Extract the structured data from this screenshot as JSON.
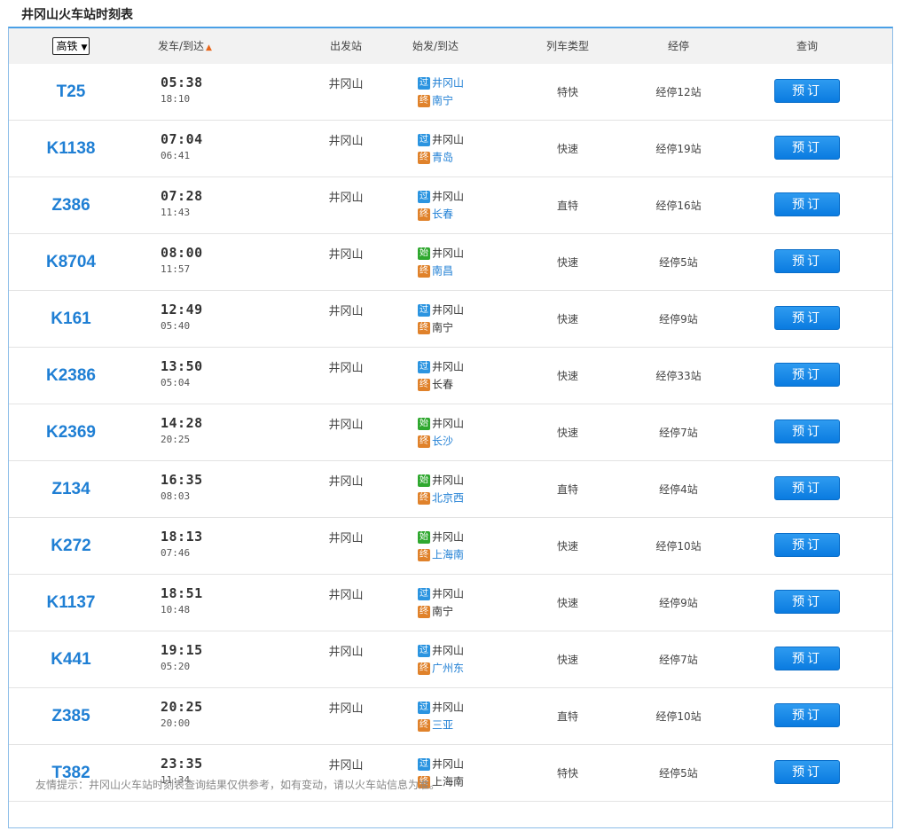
{
  "page_title": "井冈山火车站时刻表",
  "header": {
    "filter_value": "高铁",
    "dep_arr": "发车/到达",
    "station": "出发站",
    "route": "始发/到达",
    "type": "列车类型",
    "stops": "经停",
    "query": "查询"
  },
  "icons": {
    "sort": "sort-up-arrow-icon",
    "select": "dropdown-arrow-icon"
  },
  "colors": {
    "train_no": "#1f7fd4",
    "pass_tag": "#2b94e0",
    "start_tag": "#2fa82f",
    "end_tag": "#e0822b",
    "book_button": "#1a88e8"
  },
  "trains": [
    {
      "no": "T25",
      "dep": "05:38",
      "arr": "18:10",
      "station": "井冈山",
      "tag1": "过",
      "tag1_kind": "pass",
      "from": "井冈山",
      "from_link": true,
      "tag2": "终",
      "to": "南宁",
      "to_link": true,
      "type": "特快",
      "stops": "经停12站",
      "book": "预订"
    },
    {
      "no": "K1138",
      "dep": "07:04",
      "arr": "06:41",
      "station": "井冈山",
      "tag1": "过",
      "tag1_kind": "pass",
      "from": "井冈山",
      "from_link": false,
      "tag2": "终",
      "to": "青岛",
      "to_link": true,
      "type": "快速",
      "stops": "经停19站",
      "book": "预订"
    },
    {
      "no": "Z386",
      "dep": "07:28",
      "arr": "11:43",
      "station": "井冈山",
      "tag1": "过",
      "tag1_kind": "pass",
      "from": "井冈山",
      "from_link": false,
      "tag2": "终",
      "to": "长春",
      "to_link": true,
      "type": "直特",
      "stops": "经停16站",
      "book": "预订"
    },
    {
      "no": "K8704",
      "dep": "08:00",
      "arr": "11:57",
      "station": "井冈山",
      "tag1": "始",
      "tag1_kind": "start",
      "from": "井冈山",
      "from_link": false,
      "tag2": "终",
      "to": "南昌",
      "to_link": true,
      "type": "快速",
      "stops": "经停5站",
      "book": "预订"
    },
    {
      "no": "K161",
      "dep": "12:49",
      "arr": "05:40",
      "station": "井冈山",
      "tag1": "过",
      "tag1_kind": "pass",
      "from": "井冈山",
      "from_link": false,
      "tag2": "终",
      "to": "南宁",
      "to_link": false,
      "type": "快速",
      "stops": "经停9站",
      "book": "预订"
    },
    {
      "no": "K2386",
      "dep": "13:50",
      "arr": "05:04",
      "station": "井冈山",
      "tag1": "过",
      "tag1_kind": "pass",
      "from": "井冈山",
      "from_link": false,
      "tag2": "终",
      "to": "长春",
      "to_link": false,
      "type": "快速",
      "stops": "经停33站",
      "book": "预订"
    },
    {
      "no": "K2369",
      "dep": "14:28",
      "arr": "20:25",
      "station": "井冈山",
      "tag1": "始",
      "tag1_kind": "start",
      "from": "井冈山",
      "from_link": false,
      "tag2": "终",
      "to": "长沙",
      "to_link": true,
      "type": "快速",
      "stops": "经停7站",
      "book": "预订"
    },
    {
      "no": "Z134",
      "dep": "16:35",
      "arr": "08:03",
      "station": "井冈山",
      "tag1": "始",
      "tag1_kind": "start",
      "from": "井冈山",
      "from_link": false,
      "tag2": "终",
      "to": "北京西",
      "to_link": true,
      "type": "直特",
      "stops": "经停4站",
      "book": "预订"
    },
    {
      "no": "K272",
      "dep": "18:13",
      "arr": "07:46",
      "station": "井冈山",
      "tag1": "始",
      "tag1_kind": "start",
      "from": "井冈山",
      "from_link": false,
      "tag2": "终",
      "to": "上海南",
      "to_link": true,
      "type": "快速",
      "stops": "经停10站",
      "book": "预订"
    },
    {
      "no": "K1137",
      "dep": "18:51",
      "arr": "10:48",
      "station": "井冈山",
      "tag1": "过",
      "tag1_kind": "pass",
      "from": "井冈山",
      "from_link": false,
      "tag2": "终",
      "to": "南宁",
      "to_link": false,
      "type": "快速",
      "stops": "经停9站",
      "book": "预订"
    },
    {
      "no": "K441",
      "dep": "19:15",
      "arr": "05:20",
      "station": "井冈山",
      "tag1": "过",
      "tag1_kind": "pass",
      "from": "井冈山",
      "from_link": false,
      "tag2": "终",
      "to": "广州东",
      "to_link": true,
      "type": "快速",
      "stops": "经停7站",
      "book": "预订"
    },
    {
      "no": "Z385",
      "dep": "20:25",
      "arr": "20:00",
      "station": "井冈山",
      "tag1": "过",
      "tag1_kind": "pass",
      "from": "井冈山",
      "from_link": false,
      "tag2": "终",
      "to": "三亚",
      "to_link": true,
      "type": "直特",
      "stops": "经停10站",
      "book": "预订"
    },
    {
      "no": "T382",
      "dep": "23:35",
      "arr": "11:34",
      "station": "井冈山",
      "tag1": "过",
      "tag1_kind": "pass",
      "from": "井冈山",
      "from_link": false,
      "tag2": "终",
      "to": "上海南",
      "to_link": false,
      "type": "特快",
      "stops": "经停5站",
      "book": "预订"
    }
  ],
  "tip": "友情提示：井冈山火车站时刻表查询结果仅供参考，如有变动，请以火车站信息为准。"
}
